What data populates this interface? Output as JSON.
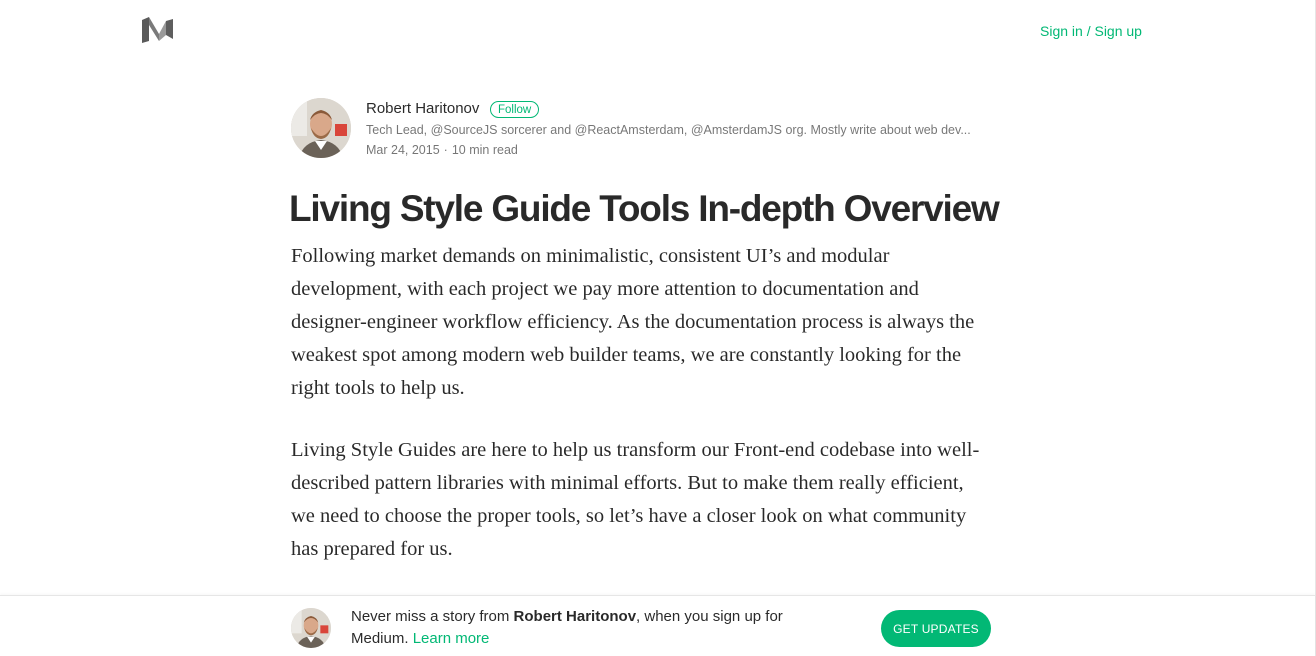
{
  "header": {
    "logo_icon": "medium-logo-icon",
    "signin_label": "Sign in / Sign up"
  },
  "author": {
    "name": "Robert Haritonov",
    "follow_label": "Follow",
    "bio": "Tech Lead, @SourceJS sorcerer and @ReactAmsterdam, @AmsterdamJS org. Mostly write about web dev...",
    "date": "Mar 24, 2015",
    "separator": "·",
    "read_time": "10 min read"
  },
  "article": {
    "title": "Living Style Guide Tools In-depth Overview",
    "paragraphs": [
      "Following market demands on minimalistic, consistent UI’s and modular development, with each project we pay more attention to documentation and designer-engineer workflow efficiency. As the documentation process is always the weakest spot among modern web builder teams, we are constantly looking for the right tools to help us.",
      "Living Style Guides are here to help us transform our Front-end codebase into well-described pattern libraries with minimal efforts. But to make them really efficient, we need to choose the proper tools, so let’s have a closer look on what community has prepared for us."
    ]
  },
  "bottom_bar": {
    "text_before": "Never miss a story from ",
    "author_name": "Robert Haritonov",
    "text_after": ", when you sign up for Medium. ",
    "learn_more_label": "Learn more",
    "cta_label": "GET UPDATES"
  },
  "colors": {
    "accent": "#02b875",
    "text": "#292929",
    "muted": "#757575"
  }
}
